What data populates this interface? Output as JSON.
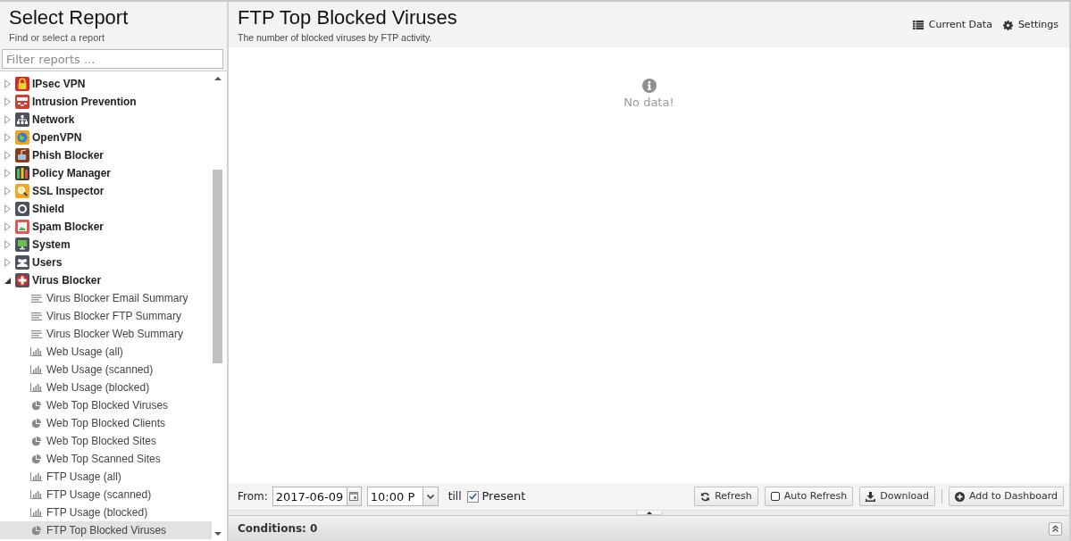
{
  "sidebar": {
    "title": "Select Report",
    "subtitle": "Find or select a report",
    "filter": {
      "placeholder": "Filter reports ..."
    },
    "tree": [
      {
        "label": "IPsec VPN",
        "expanded": false,
        "selected": false
      },
      {
        "label": "Intrusion Prevention",
        "expanded": false,
        "selected": false
      },
      {
        "label": "Network",
        "expanded": false,
        "selected": false
      },
      {
        "label": "OpenVPN",
        "expanded": false,
        "selected": false
      },
      {
        "label": "Phish Blocker",
        "expanded": false,
        "selected": false
      },
      {
        "label": "Policy Manager",
        "expanded": false,
        "selected": false
      },
      {
        "label": "SSL Inspector",
        "expanded": false,
        "selected": false
      },
      {
        "label": "Shield",
        "expanded": false,
        "selected": false
      },
      {
        "label": "Spam Blocker",
        "expanded": false,
        "selected": false
      },
      {
        "label": "System",
        "expanded": false,
        "selected": false
      },
      {
        "label": "Users",
        "expanded": false,
        "selected": false
      },
      {
        "label": "Virus Blocker",
        "expanded": true,
        "selected": false,
        "children": [
          {
            "label": "Virus Blocker Email Summary",
            "kind": "text",
            "selected": false
          },
          {
            "label": "Virus Blocker FTP Summary",
            "kind": "text",
            "selected": false
          },
          {
            "label": "Virus Blocker Web Summary",
            "kind": "text",
            "selected": false
          },
          {
            "label": "Web Usage (all)",
            "kind": "bar",
            "selected": false
          },
          {
            "label": "Web Usage (scanned)",
            "kind": "bar",
            "selected": false
          },
          {
            "label": "Web Usage (blocked)",
            "kind": "bar",
            "selected": false
          },
          {
            "label": "Web Top Blocked Viruses",
            "kind": "pie",
            "selected": false
          },
          {
            "label": "Web Top Blocked Clients",
            "kind": "pie",
            "selected": false
          },
          {
            "label": "Web Top Blocked Sites",
            "kind": "pie",
            "selected": false
          },
          {
            "label": "Web Top Scanned Sites",
            "kind": "pie",
            "selected": false
          },
          {
            "label": "FTP Usage (all)",
            "kind": "bar",
            "selected": false
          },
          {
            "label": "FTP Usage (scanned)",
            "kind": "bar",
            "selected": false
          },
          {
            "label": "FTP Usage (blocked)",
            "kind": "bar",
            "selected": false
          },
          {
            "label": "FTP Top Blocked Viruses",
            "kind": "pie",
            "selected": true
          }
        ]
      }
    ]
  },
  "report": {
    "title": "FTP Top Blocked Viruses",
    "subtitle": "The number of blocked viruses by FTP activity.",
    "actions": [
      {
        "label": "Current Data"
      },
      {
        "label": "Settings"
      }
    ],
    "empty_message": "No data!"
  },
  "toolbar": {
    "from_label": "From:",
    "date": {
      "value": "2017-06-09"
    },
    "time": {
      "value": "10:00 P"
    },
    "till_label": "till",
    "present": {
      "label": "Present",
      "checked": true
    },
    "refresh_button": {
      "label": "Refresh"
    },
    "auto_refresh": {
      "label": "Auto Refresh",
      "checked": false
    },
    "download_button": {
      "label": "Download"
    },
    "dashboard_button": {
      "label": "Add to Dashboard"
    }
  },
  "conditions": {
    "title": "Conditions: 0"
  }
}
